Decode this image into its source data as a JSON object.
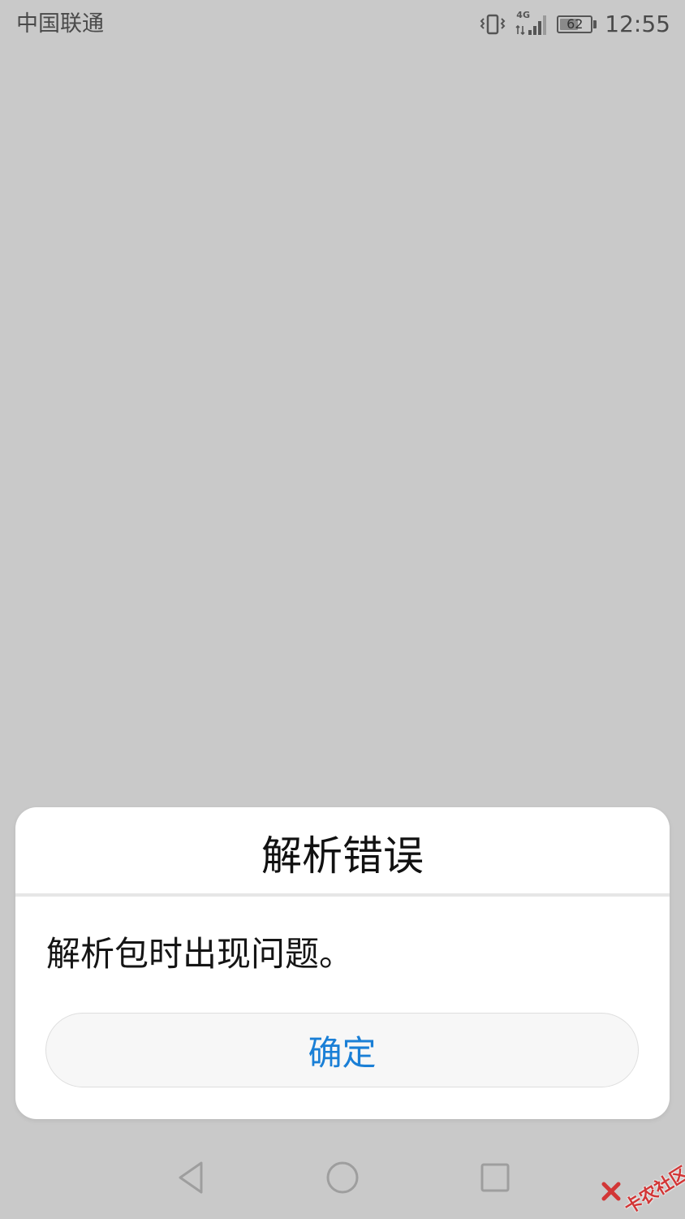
{
  "status_bar": {
    "carrier": "中国联通",
    "network_label": "4G",
    "battery_level": "62",
    "time": "12:55",
    "icons": {
      "vibrate": "vibrate-icon",
      "signal": "signal-icon",
      "battery": "battery-icon"
    }
  },
  "dialog": {
    "title": "解析错误",
    "message": "解析包时出现问题。",
    "confirm_label": "确定"
  },
  "nav_bar": {
    "icons": [
      "back-icon",
      "home-icon",
      "recents-icon"
    ]
  },
  "watermark": {
    "text": "卡农社区"
  },
  "colors": {
    "background": "#c9c9c9",
    "dialog_background": "#ffffff",
    "accent": "#1a7fd6",
    "watermark": "#d23636"
  }
}
